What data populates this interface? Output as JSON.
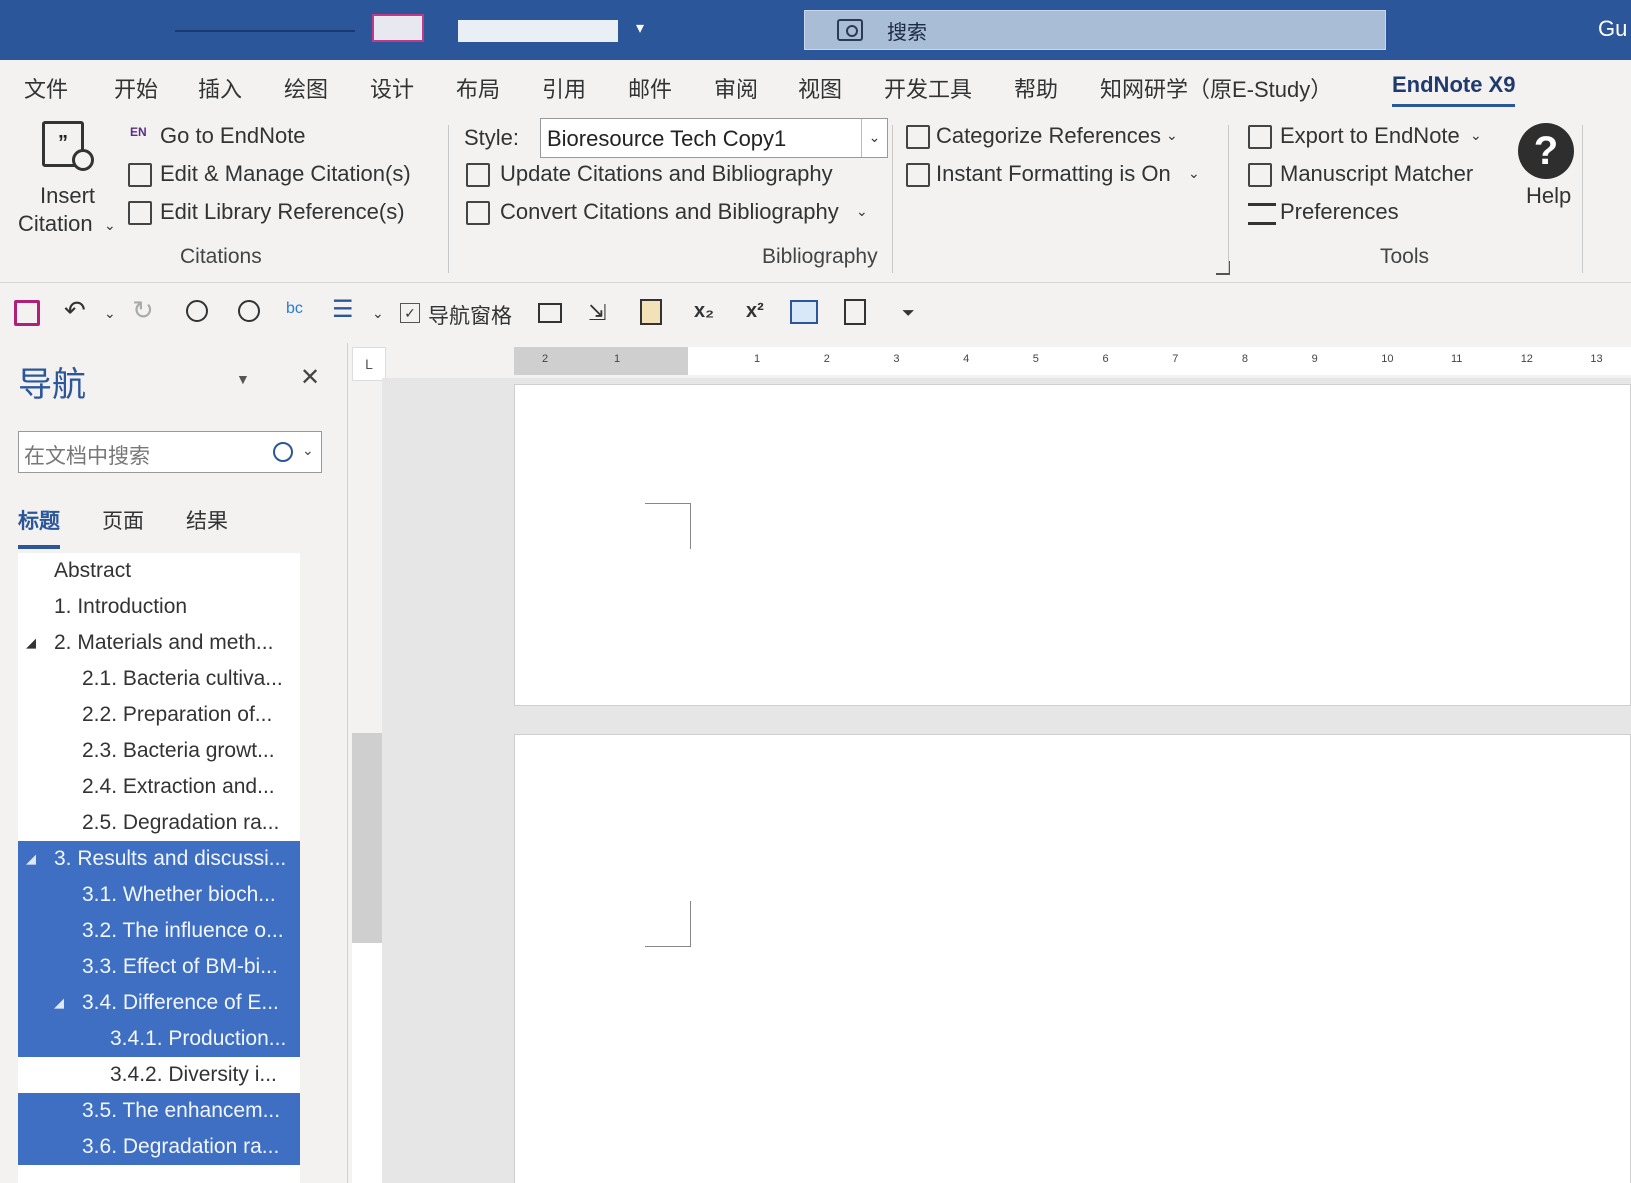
{
  "title_bar": {
    "search_placeholder": "搜索",
    "user_initials": "Gu"
  },
  "tabs": [
    "文件",
    "开始",
    "插入",
    "绘图",
    "设计",
    "布局",
    "引用",
    "邮件",
    "审阅",
    "视图",
    "开发工具",
    "帮助",
    "知网研学（原E-Study）",
    "EndNote X9"
  ],
  "active_tab": "EndNote X9",
  "ribbon": {
    "citations": {
      "insert_citation_line1": "Insert",
      "insert_citation_line2": "Citation",
      "go_to_endnote": "Go to EndNote",
      "edit_manage_citations": "Edit & Manage Citation(s)",
      "edit_library_references": "Edit Library Reference(s)",
      "group_label": "Citations"
    },
    "bibliography": {
      "style_label": "Style:",
      "style_value": "Bioresource Tech Copy1",
      "update_citations": "Update Citations and Bibliography",
      "convert_citations": "Convert Citations and Bibliography",
      "categorize_references": "Categorize References",
      "instant_formatting": "Instant Formatting is On",
      "group_label": "Bibliography"
    },
    "tools": {
      "export_to_endnote": "Export to EndNote",
      "manuscript_matcher": "Manuscript Matcher",
      "preferences": "Preferences",
      "help": "Help",
      "group_label": "Tools"
    }
  },
  "qat": {
    "nav_pane_label": "导航窗格",
    "subscript": "x₂",
    "superscript": "x²"
  },
  "nav_pane": {
    "title": "导航",
    "search_placeholder": "在文档中搜索",
    "tabs": [
      "标题",
      "页面",
      "结果"
    ],
    "active_tab": "标题",
    "headings": [
      {
        "label": "Abstract",
        "level": 1,
        "selected": false,
        "expanded": null
      },
      {
        "label": "1. Introduction",
        "level": 1,
        "selected": false,
        "expanded": null
      },
      {
        "label": "2. Materials and meth...",
        "level": 1,
        "selected": false,
        "expanded": true
      },
      {
        "label": "2.1. Bacteria cultiva...",
        "level": 2,
        "selected": false,
        "expanded": null
      },
      {
        "label": "2.2. Preparation of...",
        "level": 2,
        "selected": false,
        "expanded": null
      },
      {
        "label": "2.3. Bacteria growt...",
        "level": 2,
        "selected": false,
        "expanded": null
      },
      {
        "label": "2.4. Extraction and...",
        "level": 2,
        "selected": false,
        "expanded": null
      },
      {
        "label": "2.5. Degradation ra...",
        "level": 2,
        "selected": false,
        "expanded": null
      },
      {
        "label": "3. Results and discussi...",
        "level": 1,
        "selected": true,
        "expanded": true
      },
      {
        "label": "3.1. Whether bioch...",
        "level": 2,
        "selected": true,
        "expanded": null
      },
      {
        "label": "3.2. The influence o...",
        "level": 2,
        "selected": true,
        "expanded": null
      },
      {
        "label": "3.3. Effect of BM-bi...",
        "level": 2,
        "selected": true,
        "expanded": null
      },
      {
        "label": "3.4. Difference of E...",
        "level": 2,
        "selected": true,
        "expanded": true
      },
      {
        "label": "3.4.1. Production...",
        "level": 3,
        "selected": true,
        "expanded": null
      },
      {
        "label": "3.4.2. Diversity i...",
        "level": 3,
        "selected": false,
        "expanded": null
      },
      {
        "label": "3.5. The enhancem...",
        "level": 2,
        "selected": true,
        "expanded": null
      },
      {
        "label": "3.6. Degradation ra...",
        "level": 2,
        "selected": true,
        "expanded": null
      }
    ]
  },
  "ruler": {
    "corner_glyph": "L",
    "numbers": [
      "2",
      "1",
      "1",
      "2",
      "3",
      "4",
      "5",
      "6",
      "7",
      "8",
      "9",
      "10",
      "11",
      "12",
      "13"
    ]
  },
  "colors": {
    "title_bar": "#2b579a",
    "selection": "#3e6fc2",
    "accent": "#2b579a"
  }
}
